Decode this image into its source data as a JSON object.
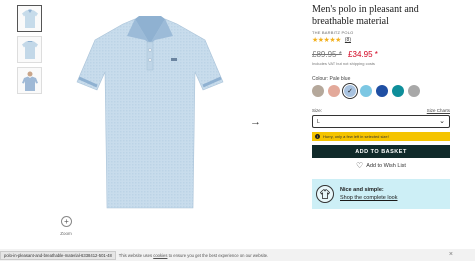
{
  "product": {
    "title": "Men's polo in pleasant and breathable material",
    "brand": "THE BARBITZ POLO",
    "stars": "★★★★★",
    "review_count": "(8)",
    "old_price": "£89.95 *",
    "new_price": "£34.95 *",
    "vat_note": "Includes VAT but not shipping costs"
  },
  "colour": {
    "label": "Colour: Pale blue",
    "swatches": [
      {
        "name": "taupe",
        "color": "#b5a89b"
      },
      {
        "name": "salmon",
        "color": "#e3a99a"
      },
      {
        "name": "pale-blue",
        "color": "#a9c3e0",
        "selected": true
      },
      {
        "name": "sky-blue",
        "color": "#7cc7e3"
      },
      {
        "name": "royal-blue",
        "color": "#1f4fa3"
      },
      {
        "name": "teal",
        "color": "#0e8e9a"
      },
      {
        "name": "grey",
        "color": "#a8a8a8"
      }
    ]
  },
  "size": {
    "label": "Size:",
    "chart_link": "Size Charts",
    "selected": "L"
  },
  "notice": {
    "icon": "!",
    "text": "Hurry, only a few left in selected size!"
  },
  "actions": {
    "basket": "ADD TO BASKET",
    "wishlist": "Add to Wish List"
  },
  "promo": {
    "title": "Nice and simple:",
    "link": "Shop the complete look"
  },
  "gallery": {
    "zoom_label": "Zoom",
    "zoom_symbol": "+",
    "next_arrow": "→"
  },
  "cookie": {
    "url": "polo-in-pleasant-and-breathable-material-6338412-501-48",
    "text_before": "This website uses",
    "link": "cookies",
    "text_after": "to ensure you get the best experience on our website.",
    "close": "×"
  },
  "colors": {
    "shirt_body": "#c6dbea",
    "shirt_collar": "#8fb1d1",
    "button_dark": "#102a2a",
    "notice_yellow": "#f5c400",
    "promo_bg": "#cdeff6",
    "sale_red": "#d2001e"
  }
}
